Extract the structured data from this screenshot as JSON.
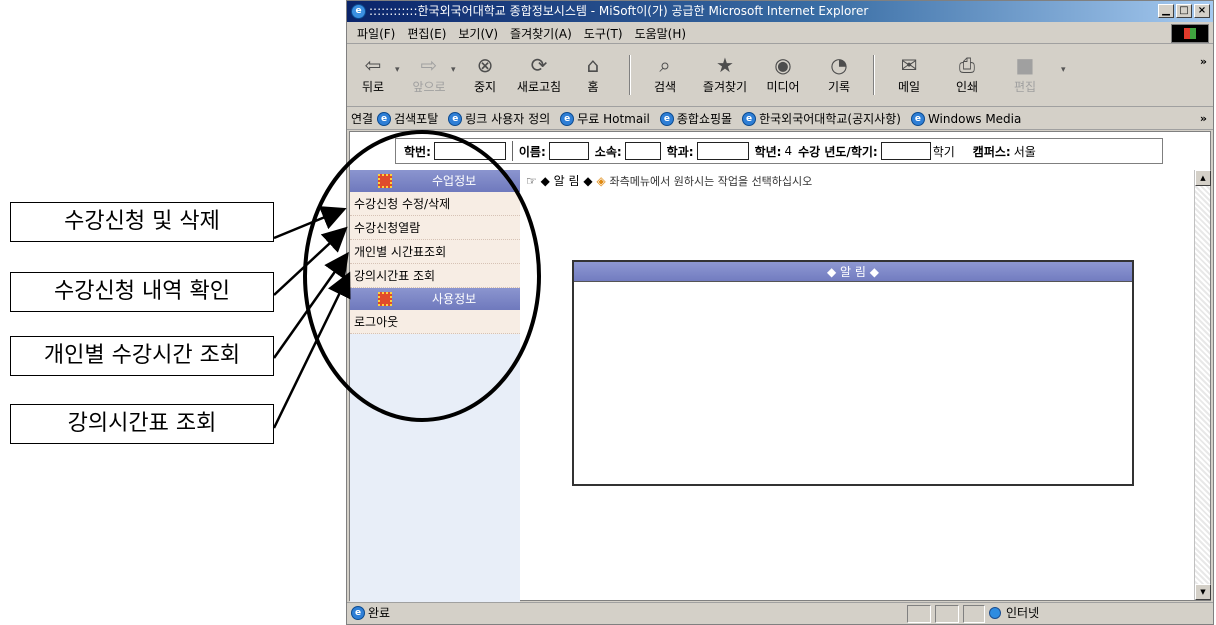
{
  "window": {
    "title": "::::::::::::한국외국어대학교 종합정보시스템 - MiSoft이(가) 공급한 Microsoft Internet Explorer",
    "controls": {
      "minimize": "▁",
      "maximize": "□",
      "close": "×"
    }
  },
  "menubar": [
    "파일(F)",
    "편집(E)",
    "보기(V)",
    "즐겨찾기(A)",
    "도구(T)",
    "도움말(H)"
  ],
  "toolbar": {
    "back": "뒤로",
    "forward": "앞으로",
    "stop": "중지",
    "refresh": "새로고침",
    "home": "홈",
    "search": "검색",
    "favorites": "즐겨찾기",
    "media": "미디어",
    "history": "기록",
    "mail": "메일",
    "print": "인쇄",
    "edit": "편집",
    "more": "»"
  },
  "linksbar": {
    "label": "연결",
    "links": [
      "검색포탈",
      "링크 사용자 정의",
      "무료 Hotmail",
      "종합쇼핑몰",
      "한국외국어대학교(공지사항)",
      "Windows Media"
    ],
    "more": "»"
  },
  "infobar": {
    "student_id_label": "학번:",
    "name_label": "이름:",
    "affiliation_label": "소속:",
    "department_label": "학과:",
    "year_label": "학년:",
    "year_value": "4",
    "term_label": "수강 년도/학기:",
    "term_suffix": "학기",
    "campus_label": "캠퍼스:",
    "campus_value": "서울"
  },
  "sidebar": {
    "section1": "수업정보",
    "items1": [
      "수강신청 수정/삭제",
      "수강신청열람",
      "개인별 시간표조회",
      "강의시간표 조회"
    ],
    "section2": "사용정보",
    "items2": [
      "로그아웃"
    ]
  },
  "notice": {
    "strip_title": "알 림",
    "strip_message": "좌측메뉴에서 원하시는 작업을 선택하십시오",
    "box_title": "◆ 알 림 ◆"
  },
  "statusbar": {
    "status": "완료",
    "zone": "인터넷"
  },
  "annotations": [
    "수강신청 및 삭제",
    "수강신청 내역 확인",
    "개인별 수강시간 조회",
    "강의시간표 조회"
  ]
}
